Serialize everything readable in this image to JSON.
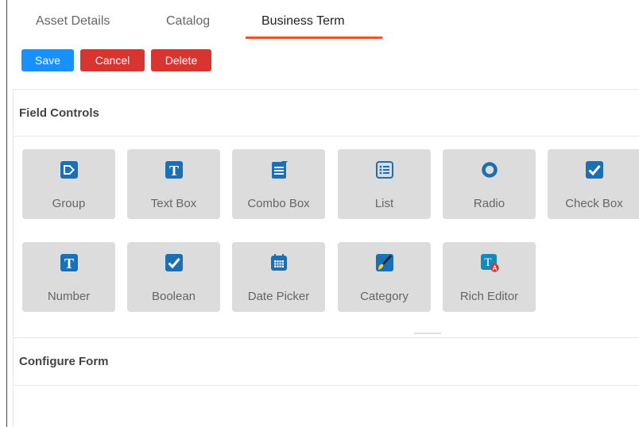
{
  "tabs": [
    {
      "label": "Asset Details",
      "active": false
    },
    {
      "label": "Catalog",
      "active": false
    },
    {
      "label": "Business Term",
      "active": true
    }
  ],
  "actions": {
    "save": "Save",
    "cancel": "Cancel",
    "delete": "Delete"
  },
  "field_controls": {
    "title": "Field Controls",
    "items": [
      {
        "label": "Group",
        "icon": "tag-icon"
      },
      {
        "label": "Text Box",
        "icon": "text-box-icon"
      },
      {
        "label": "Combo Box",
        "icon": "combo-box-icon"
      },
      {
        "label": "List",
        "icon": "list-icon"
      },
      {
        "label": "Radio",
        "icon": "radio-icon"
      },
      {
        "label": "Check Box",
        "icon": "checkbox-icon"
      },
      {
        "label": "Number",
        "icon": "number-icon"
      },
      {
        "label": "Boolean",
        "icon": "boolean-icon"
      },
      {
        "label": "Date Picker",
        "icon": "calendar-icon"
      },
      {
        "label": "Category",
        "icon": "category-icon"
      },
      {
        "label": "Rich Editor",
        "icon": "rich-editor-icon"
      }
    ]
  },
  "configure_form": {
    "title": "Configure Form"
  },
  "colors": {
    "primary": "#1891ff",
    "danger": "#d93530",
    "active_tab_underline": "#ff4d1f",
    "tile_background": "#dcdcdc",
    "icon_blue": "#1b6fb5"
  }
}
